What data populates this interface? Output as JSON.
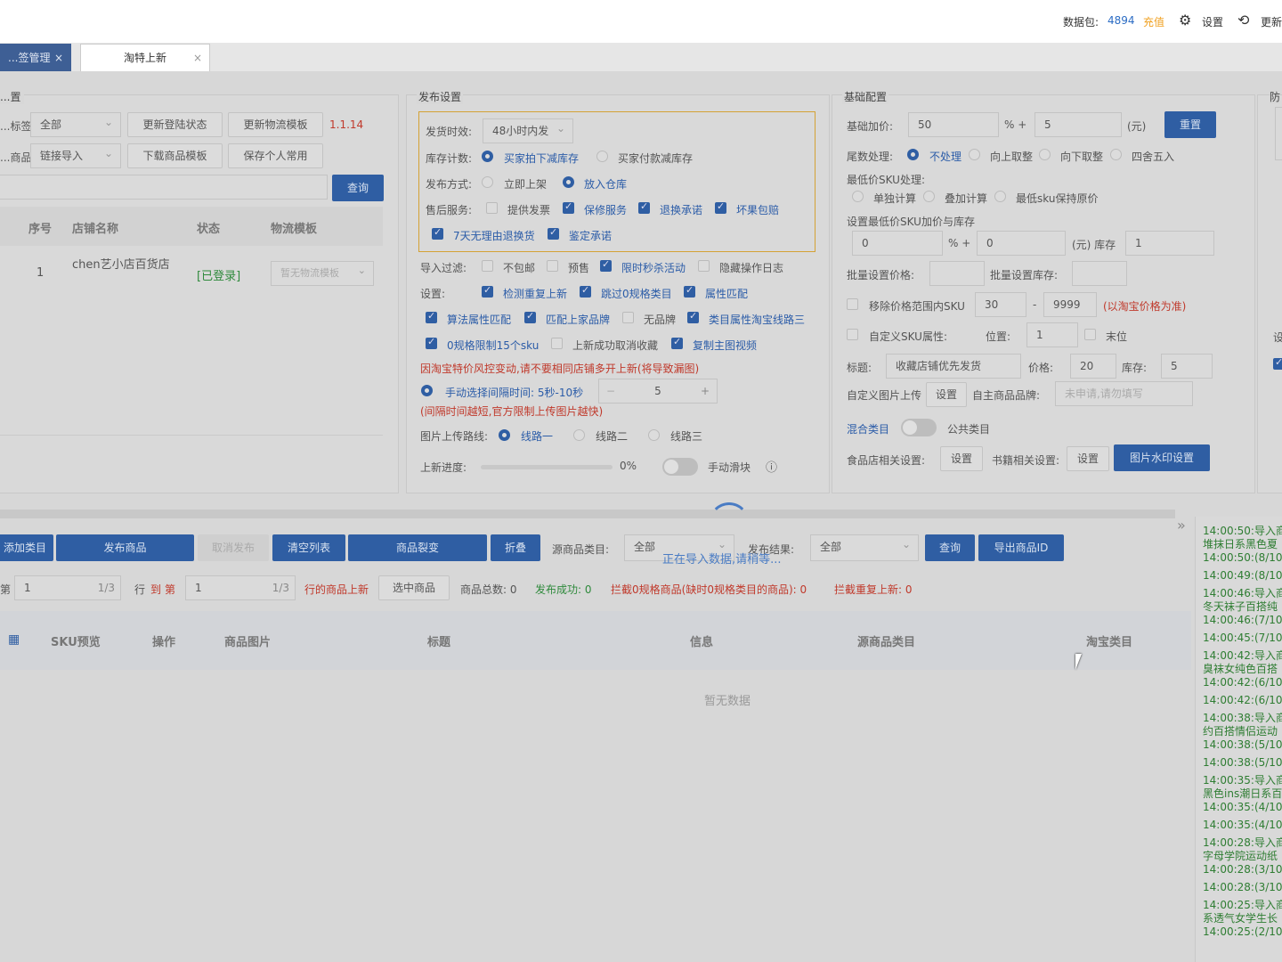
{
  "header": {
    "data_label": "数据包:",
    "data_value": "4894",
    "recharge": "充值",
    "settings": "设置",
    "update": "更新"
  },
  "tabs": [
    {
      "label": "...签管理"
    },
    {
      "label": "淘特上新"
    }
  ],
  "left": {
    "section": "...置",
    "tag_label": "...标签:",
    "tag_value": "全部",
    "goods_label": "...商品:",
    "goods_value": "链接导入",
    "btn_update_login": "更新登陆状态",
    "btn_update_logistics": "更新物流模板",
    "version": "1.1.14",
    "btn_download_tpl": "下载商品模板",
    "btn_save_common": "保存个人常用",
    "btn_query": "查询",
    "table_headers": [
      "序号",
      "店铺名称",
      "状态",
      "物流模板"
    ],
    "row": {
      "index": "1",
      "shop": "chen艺小店百货店",
      "status": "[已登录]",
      "logistics": "暂无物流模板"
    }
  },
  "publish": {
    "section": "发布设置",
    "time_label": "发货时效:",
    "time_value": "48小时内发",
    "stock_label": "库存计数:",
    "stock_opt1": "买家拍下减库存",
    "stock_opt2": "买家付款减库存",
    "mode_label": "发布方式:",
    "mode_opt1": "立即上架",
    "mode_opt2": "放入仓库",
    "after_label": "售后服务:",
    "after_opts": [
      "提供发票",
      "保修服务",
      "退换承诺",
      "坏果包赔"
    ],
    "seven_day": "7天无理由退换货",
    "appraisal": "鉴定承诺",
    "filter_label": "导入过滤:",
    "filter_opts": [
      "不包邮",
      "预售",
      "限时秒杀活动",
      "隐藏操作日志"
    ],
    "settings_label": "设置:",
    "settings_row1": [
      "检测重复上新",
      "跳过0规格类目",
      "属性匹配"
    ],
    "settings_row2": [
      "算法属性匹配",
      "匹配上家品牌",
      "无品牌",
      "类目属性淘宝线路三"
    ],
    "settings_row3": [
      "0规格限制15个sku",
      "上新成功取消收藏",
      "复制主图视频"
    ],
    "warning": "因淘宝特价风控变动,请不要相同店铺多开上新(将导致漏图)",
    "interval_label": "手动选择间隔时间: 5秒-10秒",
    "interval_value": "5",
    "interval_warning": "(间隔时间越短,官方限制上传图片越快)",
    "line_label": "图片上传路线:",
    "lines": [
      "线路一",
      "线路二",
      "线路三"
    ],
    "progress_label": "上新进度:",
    "progress_text": "0%",
    "progress": 0,
    "slider_label": "手动滑块"
  },
  "basic": {
    "section": "基础配置",
    "markup_label": "基础加价:",
    "markup_value": "50",
    "pct_plus": "% +",
    "markup_add": "5",
    "yuan": "(元)",
    "reset": "重置",
    "tail_label": "尾数处理:",
    "tail_opts": [
      "不处理",
      "向上取整",
      "向下取整",
      "四舍五入"
    ],
    "minsku_label": "最低价SKU处理:",
    "minsku_opts": [
      "单独计算",
      "叠加计算",
      "最低sku保持原价"
    ],
    "minsku_set_label": "设置最低价SKU加价与库存",
    "min_v1": "0",
    "min_v2": "0",
    "yuan_stock": "(元) 库存",
    "min_stock": "1",
    "batch_price": "批量设置价格:",
    "batch_stock": "批量设置库存:",
    "remove_range": "移除价格范围内SKU",
    "range_from": "30",
    "range_dash": "-",
    "range_to": "9999",
    "range_note": "(以淘宝价格为准)",
    "custom_sku": "自定义SKU属性:",
    "position_label": "位置:",
    "position_value": "1",
    "tail_pos": "末位",
    "title_label": "标题:",
    "title_value": "收藏店铺优先发货",
    "price_label": "价格:",
    "price_value": "20",
    "stock_label": "库存:",
    "stock_value": "5",
    "custom_img": "自定义图片上传",
    "set": "设置",
    "brand_label": "自主商品品牌:",
    "brand_placeholder": "未申请,请勿填写",
    "mixed_cat": "混合类目",
    "public_cat": "公共类目",
    "food_label": "食品店相关设置:",
    "book_label": "书籍相关设置:",
    "watermark": "图片水印设置"
  },
  "right_edge": {
    "label1": "防",
    "label2": "设"
  },
  "actions": {
    "add_cat": "添加类目",
    "publish": "发布商品",
    "cancel": "取消发布",
    "clear": "清空列表",
    "split": "商品裂变",
    "fold": "折叠",
    "src_cat_label": "源商品类目:",
    "src_cat_value": "全部",
    "result_label": "发布结果:",
    "result_value": "全部",
    "query": "查询",
    "export": "导出商品ID",
    "loading": "正在导入数据,请稍等..."
  },
  "status": {
    "row_label": "行",
    "to": "到",
    "nth": "第",
    "from_value": "1",
    "from_total": "1/3",
    "to_value": "1",
    "to_total": "1/3",
    "range_publish": "行的商品上新",
    "select_goods": "选中商品",
    "total": "商品总数: 0",
    "success": "发布成功: 0",
    "intercept0": "拦截0规格商品(缺时0规格类目的商品): 0",
    "dup": "拦截重复上新: 0"
  },
  "grid": {
    "headers": [
      "SKU预览",
      "操作",
      "商品图片",
      "标题",
      "信息",
      "源商品类目",
      "淘宝类目"
    ],
    "empty": "暂无数据"
  },
  "log": [
    "14:00:50:导入商",
    "堆抹日系黑色夏",
    "14:00:50:(8/10)",
    "14:00:49:(8/10)",
    "14:00:46:导入商",
    "冬天袜子百搭纯",
    "14:00:46:(7/10)",
    "14:00:45:(7/10)",
    "14:00:42:导入商",
    "臭袜女纯色百搭",
    "14:00:42:(6/10)",
    "14:00:42:(6/10)",
    "14:00:38:导入商",
    "约百搭情侣运动",
    "14:00:38:(5/10)",
    "14:00:38:(5/10)",
    "14:00:35:导入商",
    "黑色ins潮日系百",
    "14:00:35:(4/10)",
    "14:00:35:(4/10)",
    "14:00:28:导入商",
    "字母学院运动纸",
    "14:00:28:(3/10)",
    "14:00:28:(3/10)",
    "14:00:25:导入商",
    "系透气女学生长",
    "14:00:25:(2/10)"
  ],
  "colors": {
    "primary": "#2f5ea3",
    "danger": "#c0392b",
    "success": "#2f8a3c",
    "warn": "#f0a020"
  }
}
